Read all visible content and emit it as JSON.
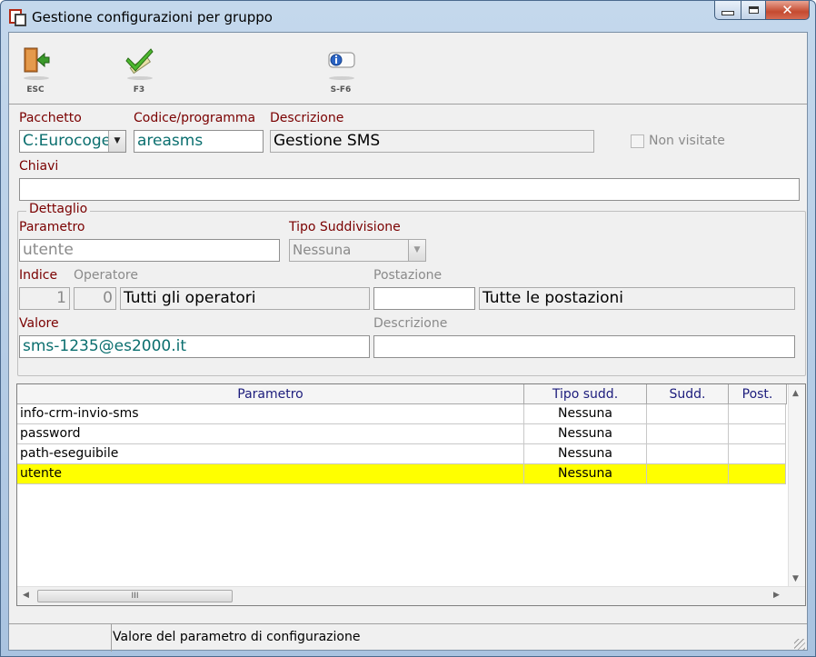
{
  "window": {
    "title": "Gestione configurazioni per gruppo"
  },
  "toolbar": [
    {
      "key": "ESC",
      "icon": "exit-door-icon"
    },
    {
      "key": "F3",
      "icon": "confirm-check-icon"
    },
    {
      "key": "S-F6",
      "icon": "info-icon"
    }
  ],
  "form": {
    "pacchetto_label": "Pacchetto",
    "pacchetto_value": "C:Eurocoge",
    "codice_label": "Codice/programma",
    "codice_value": "areasms",
    "descrizione_label": "Descrizione",
    "descrizione_value": "Gestione SMS",
    "non_visitate_label": "Non visitate",
    "chiavi_label": "Chiavi",
    "chiavi_value": ""
  },
  "dettaglio": {
    "group_title": "Dettaglio",
    "parametro_label": "Parametro",
    "parametro_value": "utente",
    "tipo_label": "Tipo Suddivisione",
    "tipo_value": "Nessuna",
    "indice_label": "Indice",
    "indice_value": "1",
    "operatore_label": "Operatore",
    "operatore_value": "0",
    "operatore_desc": "Tutti gli operatori",
    "postazione_label": "Postazione",
    "postazione_value": "",
    "postazione_desc": "Tutte le postazioni",
    "valore_label": "Valore",
    "valore_value": "sms-1235@es2000.it",
    "descrizione_label": "Descrizione",
    "descrizione_value": ""
  },
  "grid": {
    "columns": [
      "Parametro",
      "Tipo sudd.",
      "Sudd.",
      "Post."
    ],
    "rows": [
      {
        "parametro": "info-crm-invio-sms",
        "tipo": "Nessuna",
        "sudd": "",
        "post": ""
      },
      {
        "parametro": "password",
        "tipo": "Nessuna",
        "sudd": "",
        "post": ""
      },
      {
        "parametro": "path-eseguibile",
        "tipo": "Nessuna",
        "sudd": "",
        "post": ""
      },
      {
        "parametro": "utente",
        "tipo": "Nessuna",
        "sudd": "",
        "post": "",
        "selected": true
      }
    ],
    "scroll_thumb_glyph": "III"
  },
  "status": {
    "text": "Valore del parametro di configurazione"
  },
  "colors": {
    "selected_row": "#ffff00",
    "label_red": "#7a0000",
    "value_teal": "#0b6f6f"
  }
}
